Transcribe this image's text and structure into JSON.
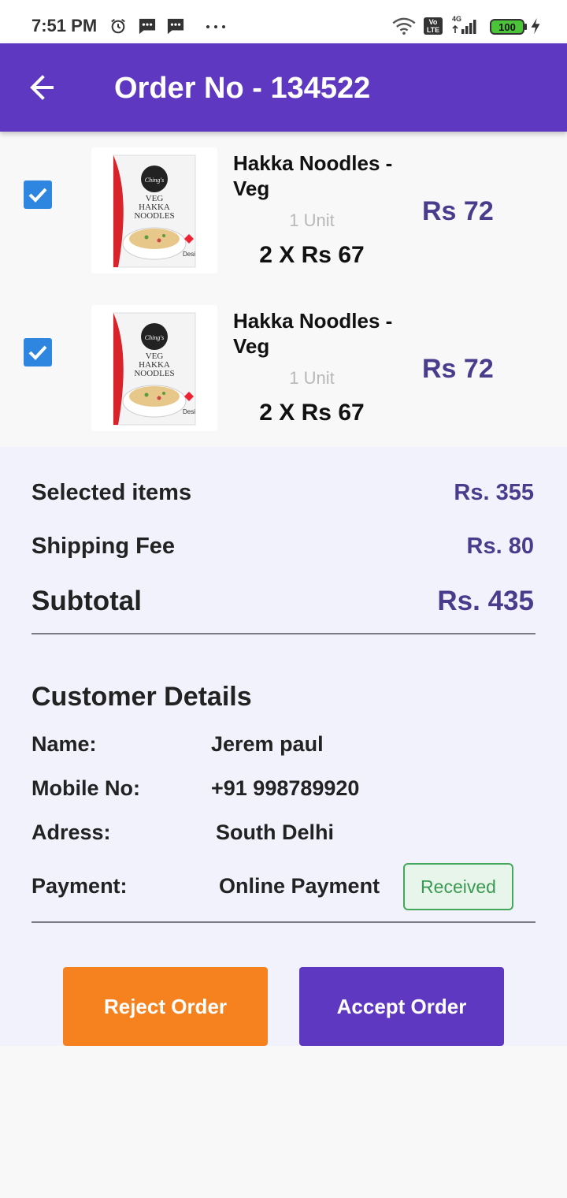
{
  "status_bar": {
    "time": "7:51 PM",
    "battery": "100",
    "network": "4G",
    "volte": "Vo LTE",
    "icons": [
      "alarm-icon",
      "message-icon",
      "message-icon",
      "more-icon",
      "wifi-icon",
      "volte-icon",
      "signal-icon",
      "battery-icon",
      "charging-icon"
    ]
  },
  "app_bar": {
    "title": "Order No - 134522",
    "back_icon": "arrow-left-icon",
    "background": "#5e38c0"
  },
  "items": [
    {
      "name": "Hakka Noodles -Veg",
      "unit": "1 Unit",
      "quantity_line": "2 X Rs 67",
      "price": "Rs 72",
      "checked": true,
      "image_text": [
        "Ching's",
        "VEG",
        "HAKKA",
        "NOODLES",
        "Desi"
      ]
    },
    {
      "name": "Hakka Noodles -Veg",
      "unit": "1 Unit",
      "quantity_line": "2 X Rs 67",
      "price": "Rs 72",
      "checked": true,
      "image_text": [
        "Ching's",
        "VEG",
        "HAKKA",
        "NOODLES",
        "Desi"
      ]
    }
  ],
  "summary": {
    "selected_label": "Selected items",
    "selected_value": "Rs. 355",
    "shipping_label": "Shipping Fee",
    "shipping_value": "Rs. 80",
    "subtotal_label": "Subtotal",
    "subtotal_value": "Rs. 435"
  },
  "customer": {
    "title": "Customer Details",
    "name_label": "Name:",
    "name_value": "Jerem paul",
    "mobile_label": "Mobile No:",
    "mobile_value": "+91 998789920",
    "address_label": "Adress:",
    "address_value": "South Delhi",
    "payment_label": "Payment:",
    "payment_value": "Online Payment",
    "payment_status": "Received"
  },
  "actions": {
    "reject_label": "Reject Order",
    "accept_label": "Accept Order",
    "reject_color": "#f5821e",
    "accept_color": "#5e38c0"
  }
}
